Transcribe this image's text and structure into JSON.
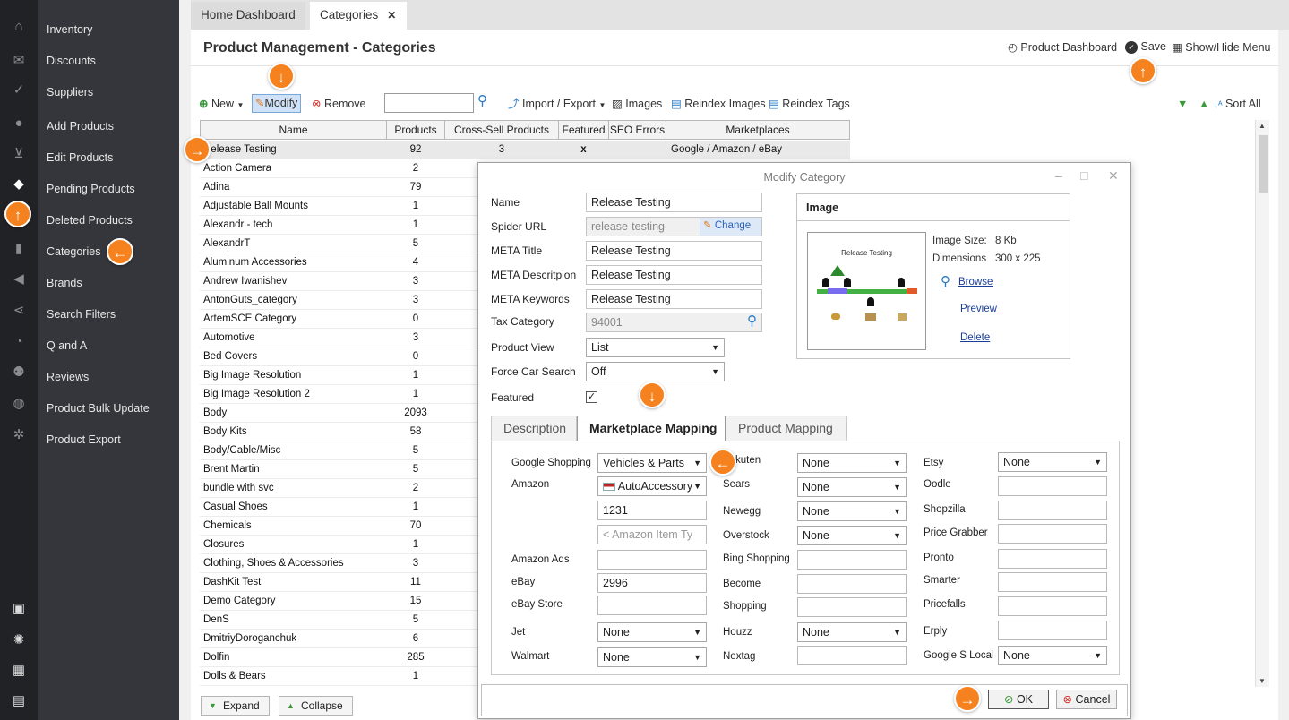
{
  "tabs": [
    "Home Dashboard",
    "Categories"
  ],
  "tab_close": "✕",
  "sidebar": [
    "Inventory",
    "Discounts",
    "Suppliers",
    "Add Products",
    "Edit Products",
    "Pending Products",
    "Deleted Products",
    "Categories",
    "Brands",
    "Search Filters",
    "Q and A",
    "Reviews",
    "Product Bulk Update",
    "Product Export"
  ],
  "page": {
    "title": "Product Management - Categories",
    "product_dashboard": "Product Dashboard",
    "save": "Save",
    "show_hide_menu": "Show/Hide Menu"
  },
  "toolbar": {
    "new": "New",
    "modify": "Modify",
    "remove": "Remove",
    "import_export": "Import / Export",
    "images": "Images",
    "reindex_images": "Reindex Images",
    "reindex_tags": "Reindex Tags",
    "sort_all": "Sort All"
  },
  "grid": {
    "columns": [
      "Name",
      "Products",
      "Cross-Sell Products",
      "Featured",
      "SEO Errors",
      "Marketplaces"
    ],
    "rows": [
      [
        "Release Testing",
        "92",
        "3",
        "x",
        "",
        "Google / Amazon / eBay"
      ],
      [
        "Action Camera",
        "2",
        "",
        "",
        "",
        ""
      ],
      [
        "Adina",
        "79",
        "",
        "",
        "",
        ""
      ],
      [
        "Adjustable Ball Mounts",
        "1",
        "",
        "",
        "",
        ""
      ],
      [
        "Alexandr - tech",
        "1",
        "",
        "",
        "",
        ""
      ],
      [
        "AlexandrT",
        "5",
        "",
        "",
        "",
        ""
      ],
      [
        "Aluminum Accessories",
        "4",
        "",
        "",
        "",
        ""
      ],
      [
        "Andrew Iwanishev",
        "3",
        "",
        "",
        "",
        ""
      ],
      [
        "AntonGuts_category",
        "3",
        "",
        "",
        "",
        ""
      ],
      [
        "ArtemSCE Category",
        "0",
        "",
        "",
        "",
        ""
      ],
      [
        "Automotive",
        "3",
        "",
        "",
        "",
        ""
      ],
      [
        "Bed Covers",
        "0",
        "",
        "",
        "",
        ""
      ],
      [
        "Big Image Resolution",
        "1",
        "",
        "",
        "",
        ""
      ],
      [
        "Big Image Resolution 2",
        "1",
        "",
        "",
        "",
        ""
      ],
      [
        "Body",
        "2093",
        "",
        "",
        "",
        ""
      ],
      [
        "Body Kits",
        "58",
        "",
        "",
        "",
        ""
      ],
      [
        "Body/Cable/Misc",
        "5",
        "",
        "",
        "",
        ""
      ],
      [
        "Brent Martin",
        "5",
        "",
        "",
        "",
        ""
      ],
      [
        "bundle with svc",
        "2",
        "",
        "",
        "",
        ""
      ],
      [
        "Casual Shoes",
        "1",
        "",
        "",
        "",
        ""
      ],
      [
        "Chemicals",
        "70",
        "",
        "",
        "",
        ""
      ],
      [
        "Closures",
        "1",
        "",
        "",
        "",
        ""
      ],
      [
        "Clothing, Shoes & Accessories",
        "3",
        "",
        "",
        "",
        ""
      ],
      [
        "DashKit Test",
        "11",
        "",
        "",
        "",
        ""
      ],
      [
        "Demo Category",
        "15",
        "",
        "",
        "",
        ""
      ],
      [
        "DenS",
        "5",
        "",
        "",
        "",
        ""
      ],
      [
        "DmitriyDoroganchuk",
        "6",
        "",
        "",
        "",
        ""
      ],
      [
        "Dolfin",
        "285",
        "",
        "",
        "",
        ""
      ],
      [
        "Dolls & Bears",
        "1",
        "",
        "",
        "",
        ""
      ]
    ]
  },
  "bottom": {
    "expand": "Expand",
    "collapse": "Collapse"
  },
  "dialog": {
    "title": "Modify Category",
    "fields": {
      "name_label": "Name",
      "name": "Release Testing",
      "spider_label": "Spider URL",
      "spider": "release-testing",
      "change": "Change",
      "meta_title_label": "META Title",
      "meta_title": "Release Testing",
      "meta_desc_label": "META Descritpion",
      "meta_desc": "Release Testing",
      "meta_kw_label": "META Keywords",
      "meta_kw": "Release Testing",
      "tax_label": "Tax Category",
      "tax": "94001",
      "view_label": "Product View",
      "view": "List",
      "force_label": "Force Car Search",
      "force": "Off",
      "featured_label": "Featured"
    },
    "image": {
      "header": "Image",
      "size_label": "Image Size:",
      "size": "8 Kb",
      "dim_label": "Dimensions",
      "dim": "300 x 225",
      "browse": "Browse",
      "preview": "Preview",
      "delete": "Delete",
      "thumb_title": "Release Testing"
    },
    "subtabs": [
      "Description",
      "Marketplace Mapping",
      "Product Mapping"
    ],
    "mapping": {
      "google_label": "Google Shopping",
      "google": "Vehicles & Parts",
      "amazon_label": "Amazon",
      "amazon": "AutoAccessory",
      "amazon_id": "1231",
      "amazon_ph": "< Amazon Item Ty",
      "amazon_ads_label": "Amazon Ads",
      "ebay_label": "eBay",
      "ebay": "2996",
      "ebay_store_label": "eBay Store",
      "jet_label": "Jet",
      "jet": "None",
      "walmart_label": "Walmart",
      "walmart": "None",
      "rakuten_label": "kuten",
      "rakuten": "None",
      "sears_label": "Sears",
      "sears": "None",
      "newegg_label": "Newegg",
      "newegg": "None",
      "overstock_label": "Overstock",
      "overstock": "None",
      "bing_label": "Bing Shopping",
      "become_label": "Become",
      "shopping_label": "Shopping",
      "houzz_label": "Houzz",
      "houzz": "None",
      "nextag_label": "Nextag",
      "etsy_label": "Etsy",
      "etsy": "None",
      "oodle_label": "Oodle",
      "shopzilla_label": "Shopzilla",
      "pricegrabber_label": "Price Grabber",
      "pronto_label": "Pronto",
      "smarter_label": "Smarter",
      "pricefalls_label": "Pricefalls",
      "erply_label": "Erply",
      "gsl_label": "Google S Local",
      "gsl": "None"
    },
    "ok": "OK",
    "cancel": "Cancel"
  },
  "colors": {
    "accent": "#f5821f",
    "sidebar": "#34363b",
    "rail": "#212226",
    "link": "#1a3e9a"
  }
}
